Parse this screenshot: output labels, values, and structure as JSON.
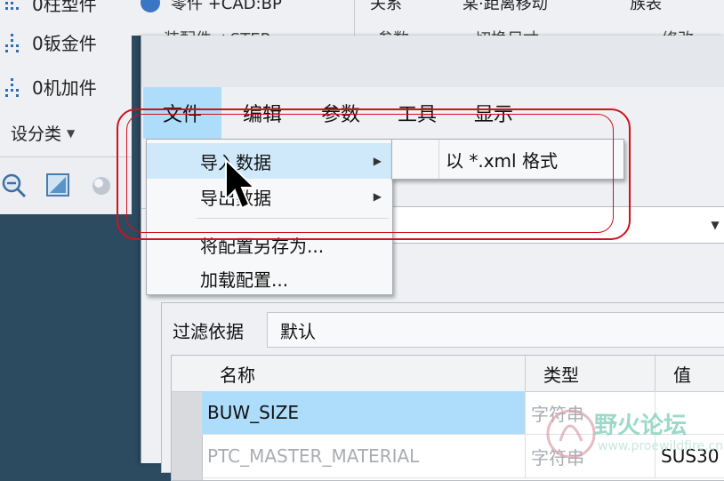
{
  "background_app": {
    "left_items": [
      {
        "label": "0柱型件"
      },
      {
        "label": "0钣金件"
      },
      {
        "label": "0机加件"
      }
    ],
    "design_class": "设分类",
    "top_items": [
      {
        "label": "零件 +CAD:BP"
      },
      {
        "label": "关系"
      },
      {
        "label": "某·距离移动"
      },
      {
        "label": "族表"
      }
    ],
    "second_row_items": [
      {
        "label": "装配件 +STEP"
      },
      {
        "label": "参数"
      },
      {
        "label": "切换尺寸"
      },
      {
        "label": "修改"
      }
    ]
  },
  "menubar": {
    "items": [
      {
        "label": "文件"
      },
      {
        "label": "编辑"
      },
      {
        "label": "参数"
      },
      {
        "label": "工具"
      },
      {
        "label": "显示"
      }
    ]
  },
  "file_menu": {
    "items": [
      {
        "label": "导入数据"
      },
      {
        "label": "导出数据"
      },
      {
        "label": "将配置另存为..."
      },
      {
        "label": "加载配置..."
      }
    ]
  },
  "import_submenu": {
    "items": [
      {
        "label": "以 *.xml 格式"
      }
    ]
  },
  "filter": {
    "label": "过滤依据",
    "value": "默认"
  },
  "table": {
    "columns": [
      "名称",
      "类型",
      "值"
    ],
    "rows": [
      {
        "name": "BUW_SIZE",
        "type": "字符串",
        "value": ""
      },
      {
        "name": "PTC_MASTER_MATERIAL",
        "type": "字符串",
        "value": "SUS30"
      }
    ]
  },
  "watermark": {
    "text": "野火论坛",
    "url": "www.proewildfire.cn"
  },
  "colors": {
    "menu_highlight": "#aeddfb",
    "annotation_red": "#d0121b",
    "desktop_bg": "#2c4a60"
  }
}
